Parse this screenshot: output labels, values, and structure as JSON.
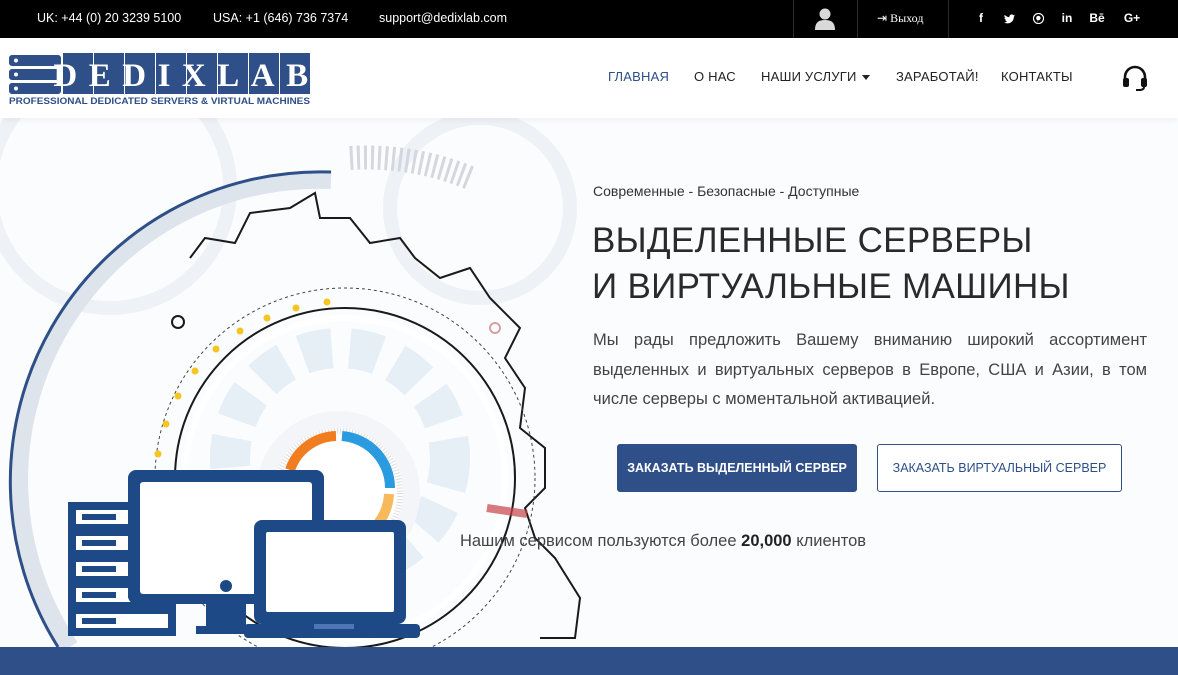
{
  "topbar": {
    "phone_uk": "UK: +44 (0) 20 3239 5100",
    "phone_usa": "USA: +1 (646) 736 7374",
    "email": "support@dedixlab.com",
    "user_icon": "user-icon",
    "logout_label": "Выход",
    "socials": [
      {
        "name": "facebook-icon",
        "glyph": "f"
      },
      {
        "name": "twitter-icon",
        "glyph": "t"
      },
      {
        "name": "pinterest-icon",
        "glyph": "p"
      },
      {
        "name": "linkedin-icon",
        "glyph": "in"
      },
      {
        "name": "behance-icon",
        "glyph": "Bē"
      },
      {
        "name": "google-plus-icon",
        "glyph": "G+"
      }
    ]
  },
  "logo": {
    "name": "DEDIXLAB",
    "tagline": "PROFESSIONAL DEDICATED SERVERS & VIRTUAL MACHINES"
  },
  "nav": {
    "items": [
      {
        "label": "ГЛАВНАЯ",
        "active": true
      },
      {
        "label": "О НАС",
        "active": false
      },
      {
        "label": "НАШИ УСЛУГИ",
        "active": false,
        "dropdown": true
      },
      {
        "label": "ЗАРАБОТАЙ!",
        "active": false
      },
      {
        "label": "КОНТАКТЫ",
        "active": false
      }
    ],
    "support_icon": "headset-icon"
  },
  "hero": {
    "tagline": "Современные - Безопасные - Доступные",
    "title_line1": "ВЫДЕЛЕННЫЕ СЕРВЕРЫ",
    "title_line2": "И ВИРТУАЛЬНЫЕ МАШИНЫ",
    "description": "Мы рады предложить Вашему вниманию широкий ассортимент выделенных и виртуальных серверов в Европе, США и Азии, в том числе серверы с моментальной активацией.",
    "btn_dedicated": "ЗАКАЗАТЬ ВЫДЕЛЕННЫЙ СЕРВЕР",
    "btn_virtual": "ЗАКАЗАТЬ ВИРТУАЛЬНЫЙ СЕРВЕР",
    "clients_prefix": "Нашим сервисом пользуются более",
    "clients_count": "20,000",
    "clients_suffix": "клиентов"
  },
  "colors": {
    "brand": "#2e4f87",
    "topbar_bg": "#000000",
    "accent_orange": "#f07d1f",
    "accent_blue": "#2b9be0",
    "accent_yellow": "#f6c522"
  }
}
